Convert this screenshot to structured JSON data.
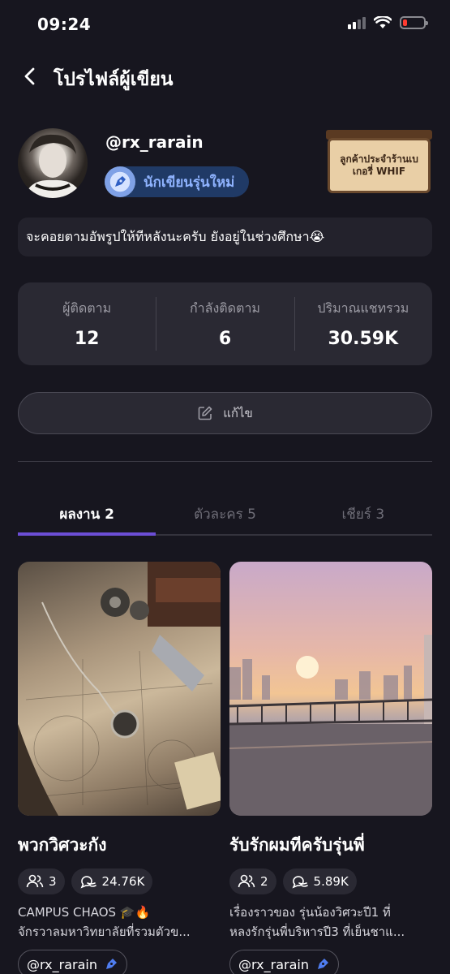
{
  "status_bar": {
    "time": "09:24"
  },
  "header": {
    "title": "โปรไฟล์ผู้เขียน"
  },
  "profile": {
    "username": "@rx_rarain",
    "badge": "นักเขียนรุ่นใหม่",
    "sign_line1": "ลูกค้าประจำร้านเบ",
    "sign_line2": "เกอรี่ WHIF",
    "bio": "จะคอยตามอัพรูปให้ทีหลังนะครับ ยังอยู่ในช่วงศึกษา😭"
  },
  "stats": [
    {
      "label": "ผู้ติดตาม",
      "value": "12"
    },
    {
      "label": "กำลังติดตาม",
      "value": "6"
    },
    {
      "label": "ปริมาณแชทรวม",
      "value": "30.59K"
    }
  ],
  "edit_button": {
    "label": "แก้ไข"
  },
  "tabs": [
    {
      "label": "ผลงาน 2"
    },
    {
      "label": "ตัวละคร 5"
    },
    {
      "label": "เชียร์ 3"
    }
  ],
  "works": [
    {
      "title": "พวกวิศวะกัง",
      "members": "3",
      "chats": "24.76K",
      "desc_line1": "CAMPUS CHAOS 🎓🔥",
      "desc_line2": "จักรวาลมหาวิทยาลัยที่รวมตัวข...",
      "author": "@rx_rarain"
    },
    {
      "title": "รับรักผมทีครับรุ่นพี่",
      "members": "2",
      "chats": "5.89K",
      "desc_line1": "เรื่องราวของ รุ่นน้องวิศวะปี1 ที่",
      "desc_line2": "หลงรักรุ่นพี่บริหารปี3 ที่เย็นชาแ...",
      "author": "@rx_rarain"
    }
  ]
}
